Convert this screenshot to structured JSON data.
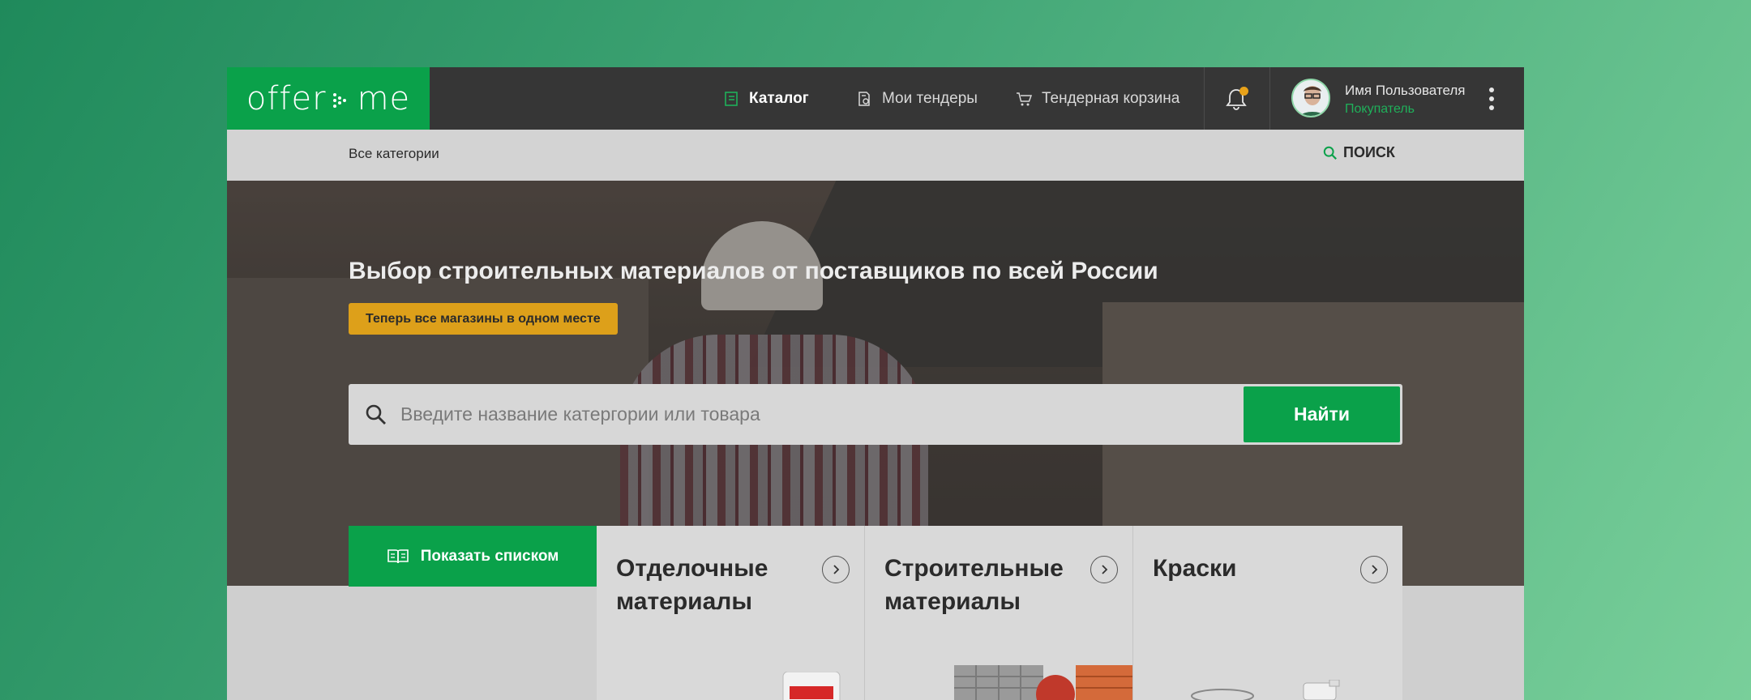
{
  "brand": {
    "logo_left": "offer",
    "logo_right": "me",
    "accent": "#0aa14a",
    "warning": "#dda01a"
  },
  "nav": {
    "catalog": "Каталог",
    "tenders": "Мои тендеры",
    "cart": "Тендерная корзина"
  },
  "user": {
    "name": "Имя Пользователя",
    "role": "Покупатель"
  },
  "subbar": {
    "all_categories": "Все категории",
    "search": "ПОИСК"
  },
  "hero": {
    "title": "Выбор строительных материалов от поставщиков по всей России",
    "badge": "Теперь все магазины в одном месте",
    "search_placeholder": "Введите название катергории или товара",
    "search_button": "Найти"
  },
  "list_button": "Показать списком",
  "categories": [
    {
      "title": "Отделочные материалы"
    },
    {
      "title": "Строительные материалы"
    },
    {
      "title": "Краски"
    }
  ]
}
